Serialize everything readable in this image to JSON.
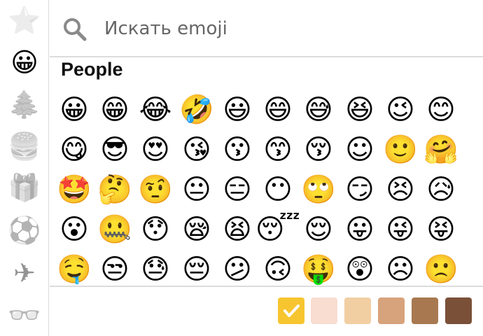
{
  "search": {
    "placeholder": "Искать emoji"
  },
  "section": {
    "title": "People"
  },
  "categories": [
    {
      "name": "recent",
      "glyph": "⭐",
      "active": false
    },
    {
      "name": "people",
      "glyph": "😀",
      "active": true
    },
    {
      "name": "nature",
      "glyph": "🌲",
      "active": false
    },
    {
      "name": "food",
      "glyph": "🍔",
      "active": false
    },
    {
      "name": "activity",
      "glyph": "🎁",
      "active": false
    },
    {
      "name": "sports",
      "glyph": "⚽",
      "active": false
    },
    {
      "name": "travel",
      "glyph": "✈",
      "active": false
    },
    {
      "name": "objects",
      "glyph": "👓",
      "active": false
    }
  ],
  "emoji_rows": [
    [
      "😀",
      "😁",
      "😂",
      "🤣",
      "😃",
      "😄",
      "😅",
      "😆",
      "😉",
      "😊"
    ],
    [
      "😋",
      "😎",
      "😍",
      "😘",
      "😗",
      "😙",
      "😚",
      "☺",
      "🙂",
      "🤗"
    ],
    [
      "🤩",
      "🤔",
      "🤨",
      "😐",
      "😑",
      "😶",
      "🙄",
      "😏",
      "😣",
      "😥"
    ],
    [
      "😮",
      "🤐",
      "😯",
      "😪",
      "😫",
      "😴",
      "😌",
      "😛",
      "😜",
      "😝"
    ],
    [
      "🤤",
      "😒",
      "😓",
      "😔",
      "😕",
      "🙃",
      "🤑",
      "😲",
      "☹",
      "🙁"
    ]
  ],
  "skin_tones": [
    {
      "name": "default",
      "color": "#f7c530",
      "selected": true
    },
    {
      "name": "light",
      "color": "#f9ddd0",
      "selected": false
    },
    {
      "name": "medium-light",
      "color": "#f2cfa3",
      "selected": false
    },
    {
      "name": "medium",
      "color": "#d7a37c",
      "selected": false
    },
    {
      "name": "medium-dark",
      "color": "#a87951",
      "selected": false
    },
    {
      "name": "dark",
      "color": "#7a5038",
      "selected": false
    }
  ],
  "icons": {
    "search": "search-icon",
    "checkmark": "checkmark-icon"
  }
}
